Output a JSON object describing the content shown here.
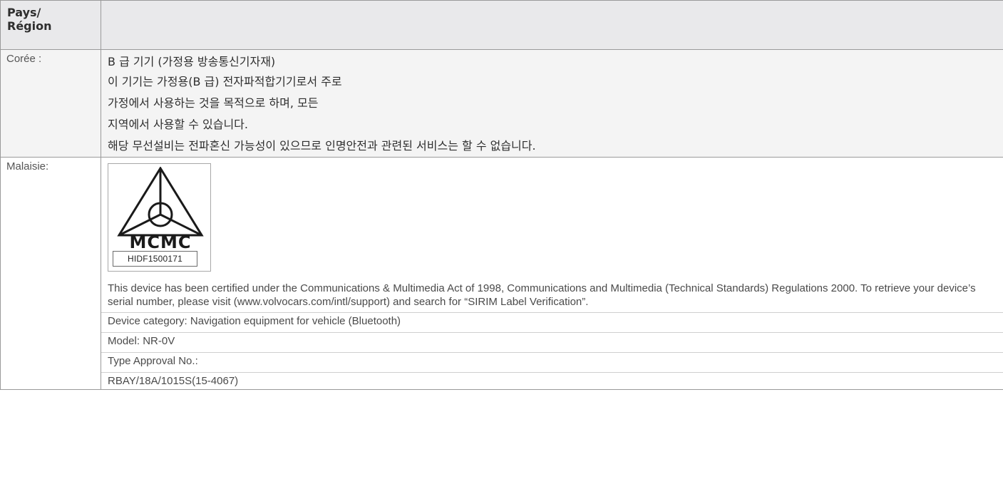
{
  "header": {
    "region_label": "Pays/\nRégion"
  },
  "korea": {
    "region": "Corée :",
    "lines": [
      "B 급 기기 (가정용 방송통신기자재)",
      "이 기기는 가정용(B 급) 전자파적합기기로서 주로",
      "가정에서 사용하는 것을 목적으로 하며, 모든",
      "지역에서 사용할 수 있습니다.",
      "해당 무선설비는 전파혼신 가능성이 있으므로 인명안전과 관련된 서비스는 할 수 없습니다."
    ]
  },
  "malaysia": {
    "region": "Malaisie:",
    "logo_text": "MCMC",
    "logo_id": "HIDF1500171",
    "certification": "This device has been certified under the Communications & Multimedia Act of 1998, Communications and Multimedia (Technical Standards) Regulations 2000. To retrieve your device’s serial number, please visit (www.volvocars.com/intl/support) and search for “SIRIM Label Verification”.",
    "device_category": "Device category: Navigation equipment for vehicle (Bluetooth)",
    "model": "Model: NR-0V",
    "type_approval_label": "Type Approval No.:",
    "type_approval_number": "RBAY/18A/1015S(15-4067)"
  }
}
